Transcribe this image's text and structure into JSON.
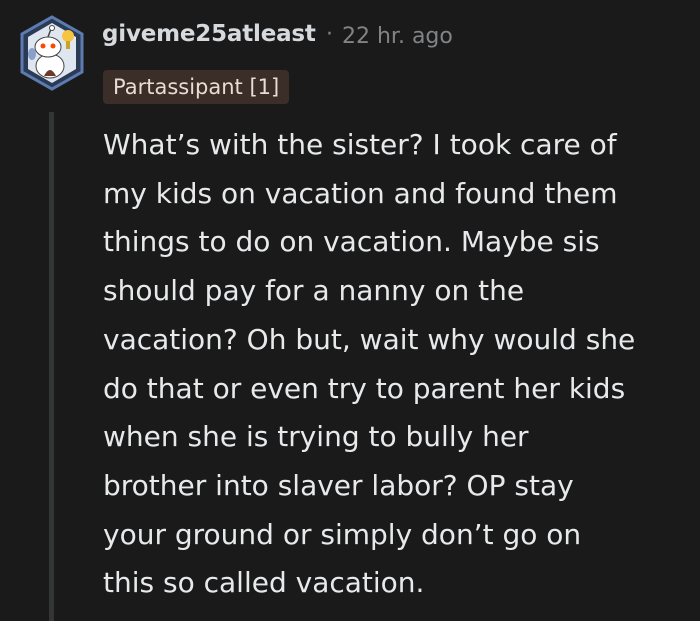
{
  "comment": {
    "username": "giveme25atleast",
    "separator": "·",
    "timestamp": "22 hr. ago",
    "flair": "Partassipant [1]",
    "body_lines": [
      "What’s with the sister? I took care of",
      "my kids on vacation and found them",
      "things to do on vacation. Maybe sis",
      "should pay for a nanny on the",
      "vacation? Oh but, wait why would she",
      "do that or even try to parent her kids",
      "when she is trying to bully her",
      "brother into slaver labor? OP stay",
      "your ground or simply don’t go on",
      "this so called vacation."
    ]
  },
  "colors": {
    "background": "#1a1a1b",
    "username": "#d7dadc",
    "meta": "#818384",
    "flair_background": "#3b2d27",
    "thread_line": "#343536"
  },
  "icons": {
    "avatar": "snoo-avatar-icon"
  }
}
